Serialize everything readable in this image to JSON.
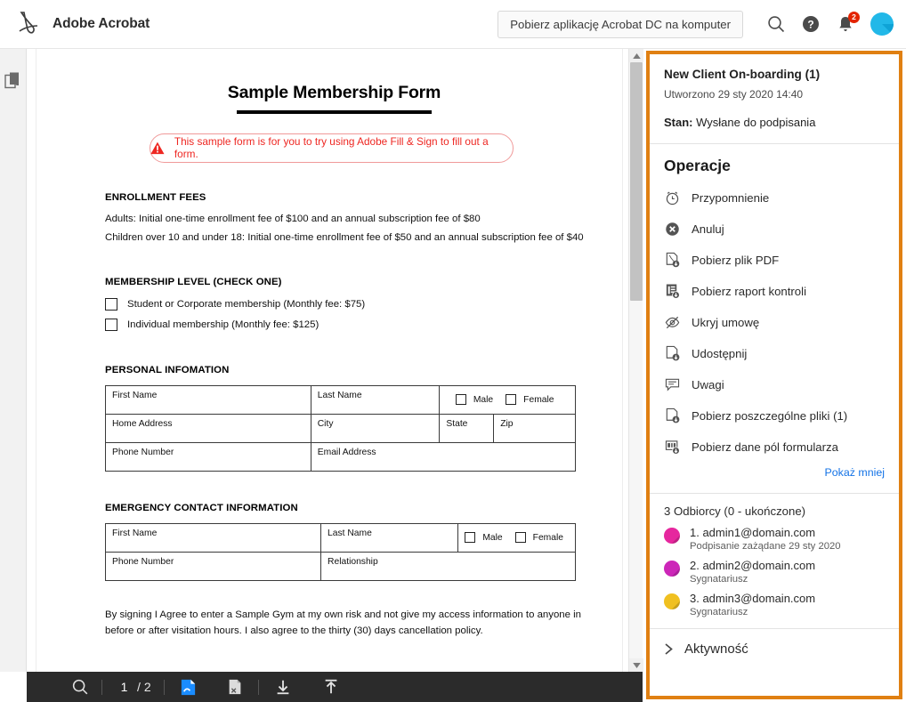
{
  "header": {
    "brand": "Adobe Acrobat",
    "logo_icon": "adobe-acrobat-logo",
    "download_button": "Pobierz aplikację Acrobat DC na komputer",
    "icons": [
      {
        "name": "search-icon",
        "label": "Szukaj"
      },
      {
        "name": "help-icon",
        "label": "Pomoc"
      },
      {
        "name": "notifications-bell-icon",
        "label": "Powiadomienia",
        "badge": "2"
      },
      {
        "name": "user-avatar",
        "label": "Konto"
      }
    ]
  },
  "left_rail": {
    "items": [
      {
        "name": "page-thumbnails-icon",
        "label": "Miniatury stron"
      }
    ]
  },
  "document": {
    "title": "Sample Membership Form",
    "warning": {
      "icon": "warning-triangle-icon",
      "text": "This sample form is for you to try using Adobe Fill & Sign to fill out a form."
    },
    "enrollment": {
      "heading": "ENROLLMENT FEES",
      "lines": [
        "Adults: Initial one-time enrollment fee of $100 and an annual subscription fee of $80",
        "Children over 10 and under 18: Initial one-time enrollment fee of $50 and an annual subscription fee of $40"
      ]
    },
    "membership": {
      "heading": "MEMBERSHIP LEVEL (CHECK ONE)",
      "options": [
        "Student or Corporate membership (Monthly fee: $75)",
        "Individual membership (Monthly fee: $125)"
      ]
    },
    "personal": {
      "heading": "PERSONAL INFOMATION",
      "fields": {
        "first_name": "First Name",
        "last_name": "Last Name",
        "male": "Male",
        "female": "Female",
        "home_address": "Home Address",
        "city": "City",
        "state": "State",
        "zip": "Zip",
        "phone": "Phone Number",
        "email": "Email Address"
      }
    },
    "emergency": {
      "heading": "EMERGENCY CONTACT INFORMATION",
      "fields": {
        "first_name": "First Name",
        "last_name": "Last Name",
        "male": "Male",
        "female": "Female",
        "phone": "Phone Number",
        "relationship": "Relationship"
      }
    },
    "agreement_text": "By signing I Agree to enter a Sample Gym at my own risk and not give my access information to anyone in before or after visitation hours. I also agree to the thirty (30) days cancellation policy."
  },
  "bottom_toolbar": {
    "search_icon": "search-icon",
    "current_page": "1",
    "page_separator": "/",
    "total_pages": "2",
    "buttons": [
      {
        "name": "fill-and-sign-icon",
        "label": "Wypełnij i podpisz"
      },
      {
        "name": "export-pdf-icon",
        "label": "Eksportuj PDF"
      },
      {
        "name": "download-icon",
        "label": "Pobierz"
      },
      {
        "name": "upload-icon",
        "label": "Prześlij"
      }
    ]
  },
  "right_panel": {
    "accent_color": "#e08012",
    "agreement": {
      "title": "New Client On-boarding (1)",
      "created": "Utworzono 29 sty 2020 14:40",
      "state_label": "Stan:",
      "state_value": "Wysłane do podpisania"
    },
    "operations": {
      "heading": "Operacje",
      "items": [
        {
          "icon": "alarm-clock-icon",
          "label": "Przypomnienie"
        },
        {
          "icon": "cancel-circle-x-icon",
          "label": "Anuluj"
        },
        {
          "icon": "download-pdf-icon",
          "label": "Pobierz plik PDF"
        },
        {
          "icon": "download-audit-report-icon",
          "label": "Pobierz raport kontroli"
        },
        {
          "icon": "hide-eye-slash-icon",
          "label": "Ukryj umowę"
        },
        {
          "icon": "share-document-icon",
          "label": "Udostępnij"
        },
        {
          "icon": "comment-bubble-icon",
          "label": "Uwagi"
        },
        {
          "icon": "download-individual-files-icon",
          "label": "Pobierz poszczególne pliki (1)"
        },
        {
          "icon": "download-form-field-data-icon",
          "label": "Pobierz dane pól formularza"
        }
      ],
      "show_less": "Pokaż mniej"
    },
    "recipients": {
      "heading": "3 Odbiorcy (0 - ukończone)",
      "items": [
        {
          "name": "1. admin1@domain.com",
          "meta": "Podpisanie zażądane 29 sty 2020",
          "color": "#e6279e"
        },
        {
          "name": "2. admin2@domain.com",
          "meta": "Sygnatariusz",
          "color": "#cc26b8"
        },
        {
          "name": "3. admin3@domain.com",
          "meta": "Sygnatariusz",
          "color": "#f0c020"
        }
      ]
    },
    "activity": {
      "icon": "chevron-right-icon",
      "label": "Aktywność"
    }
  }
}
